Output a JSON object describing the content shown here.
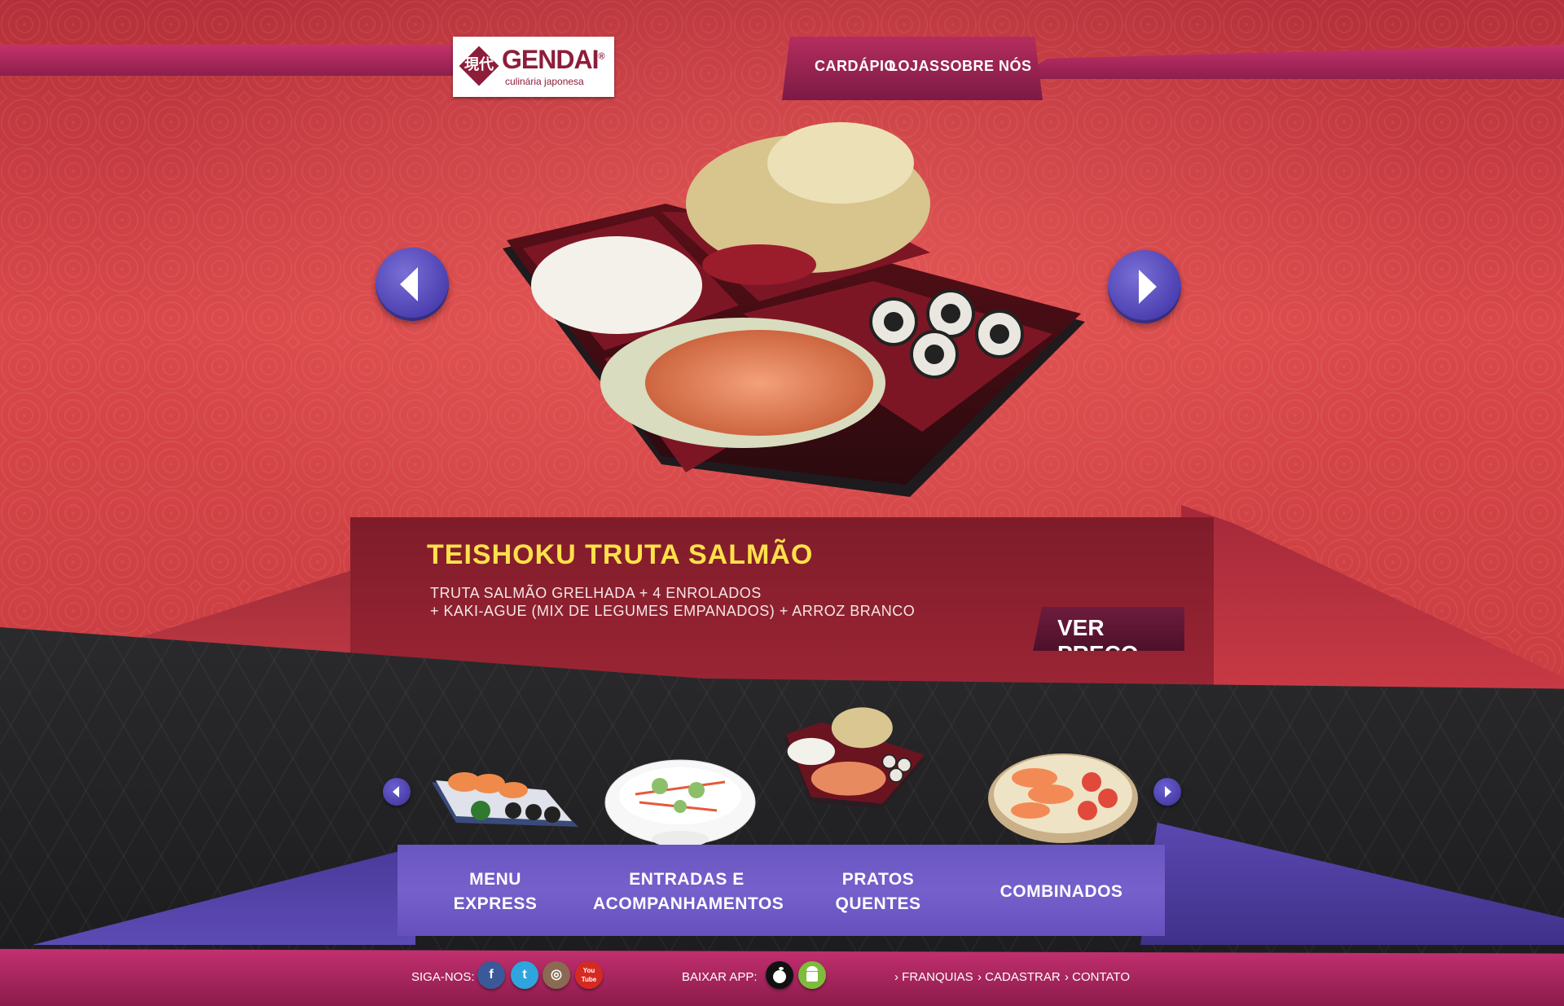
{
  "brand": {
    "name": "GENDAI",
    "tagline": "culinária japonesa",
    "kanji": "現代",
    "registered": "®"
  },
  "nav": {
    "items": [
      "CARDÁPIO",
      "LOJAS",
      "SOBRE NÓS"
    ]
  },
  "hero": {
    "dish_title": "TEISHOKU TRUTA SALMÃO",
    "dish_desc_line1": "TRUTA SALMÃO GRELHADA + 4 ENROLADOS",
    "dish_desc_line2": "+ KAKI-AGUE (MIX DE LEGUMES EMPANADOS) + ARROZ BRANCO",
    "price_button": "VER PREÇO",
    "prev_icon": "chevron-left-icon",
    "next_icon": "chevron-right-icon"
  },
  "carousel": {
    "thumbs": [
      "sushi-platter",
      "salad-bowl",
      "bento-box",
      "sashimi-plate"
    ]
  },
  "categories": [
    {
      "line1": "MENU",
      "line2": "EXPRESS"
    },
    {
      "line1": "ENTRADAS E",
      "line2": "ACOMPANHAMENTOS"
    },
    {
      "line1": "PRATOS",
      "line2": "QUENTES"
    },
    {
      "line1": "COMBINADOS",
      "line2": ""
    }
  ],
  "footer": {
    "follow_label": "SIGA-NOS:",
    "social": [
      {
        "name": "facebook-icon",
        "glyph": "f",
        "color": "#3b5998"
      },
      {
        "name": "twitter-icon",
        "glyph": "t",
        "color": "#2fa5de"
      },
      {
        "name": "instagram-icon",
        "glyph": "◎",
        "color": "#8a6a52"
      },
      {
        "name": "youtube-icon",
        "glyph": "You Tube",
        "color": "#d52a22"
      }
    ],
    "app_label": "BAIXAR APP:",
    "apps": [
      {
        "name": "apple-icon",
        "color": "#111111"
      },
      {
        "name": "android-icon",
        "color": "#7fbb3c"
      }
    ],
    "links": [
      "› FRANQUIAS",
      "› CADASTRAR",
      "› CONTATO"
    ]
  },
  "colors": {
    "accent": "#ffe14a",
    "purple": "#6a56c1",
    "crimson": "#c93c40",
    "magenta": "#b52d5e"
  }
}
